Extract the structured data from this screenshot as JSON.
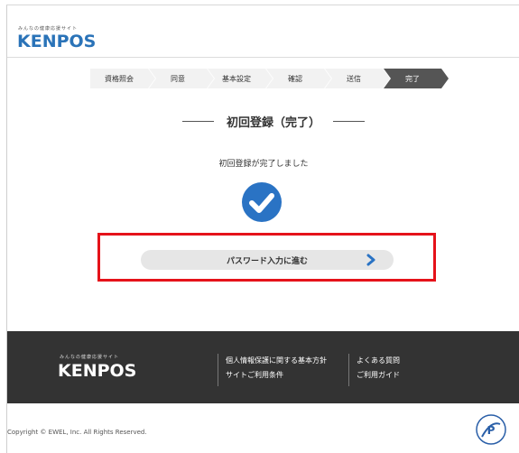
{
  "header": {
    "tagline": "みんなの健康応援サイト",
    "logo": "KENPOS"
  },
  "steps": [
    {
      "label": "資格照会",
      "active": false
    },
    {
      "label": "同意",
      "active": false
    },
    {
      "label": "基本設定",
      "active": false
    },
    {
      "label": "確認",
      "active": false
    },
    {
      "label": "送信",
      "active": false
    },
    {
      "label": "完了",
      "active": true
    }
  ],
  "main": {
    "title": "初回登録（完了）",
    "message": "初回登録が完了しました",
    "proceed_label": "パスワード入力に進む"
  },
  "footer": {
    "tagline": "みんなの健康応援サイト",
    "logo": "KENPOS",
    "links_col1": [
      "個人情報保護に関する基本方針",
      "サイトご利用条件"
    ],
    "links_col2": [
      "よくある質問",
      "ご利用ガイド"
    ]
  },
  "copyright": "Copyright © EWEL, Inc. All Rights Reserved.",
  "colors": {
    "brand_blue": "#2a73c4",
    "highlight_red": "#e5121a",
    "footer_bg": "#333333",
    "active_step": "#555555"
  }
}
